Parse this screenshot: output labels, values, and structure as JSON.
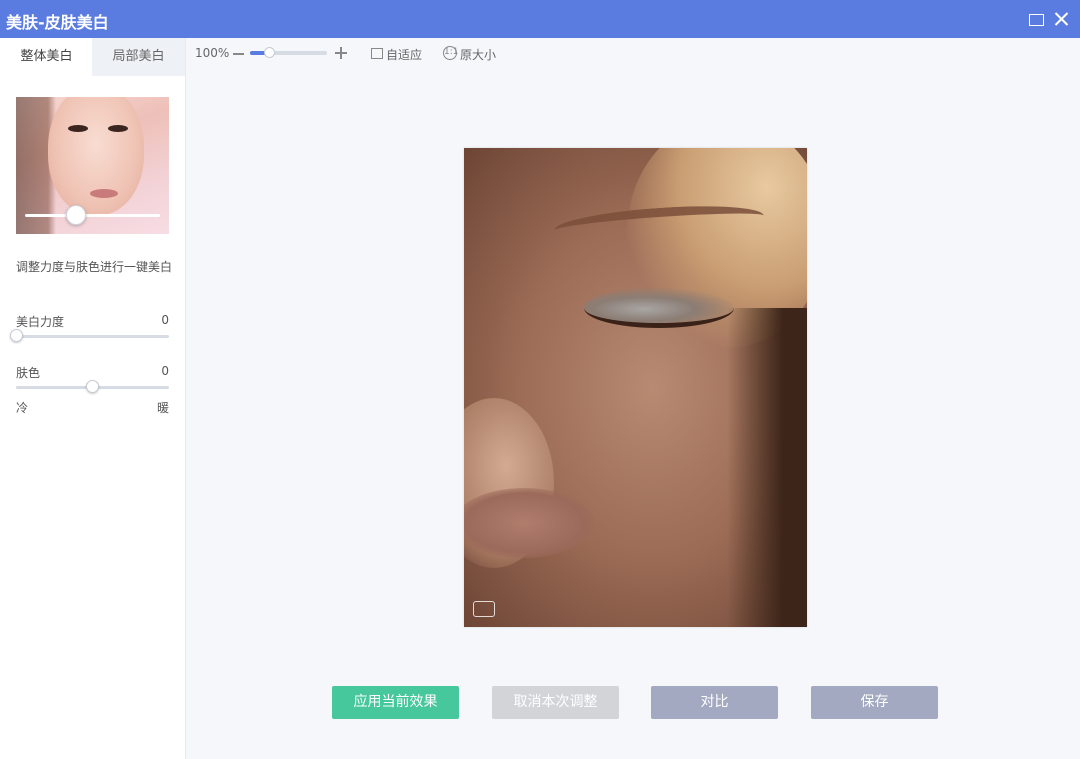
{
  "window": {
    "title": "美肤-皮肤美白"
  },
  "tabs": [
    {
      "label": "整体美白",
      "active": true
    },
    {
      "label": "局部美白",
      "active": false
    }
  ],
  "sidebar": {
    "description": "调整力度与肤色进行一键美白",
    "sliders": [
      {
        "label": "美白力度",
        "value": "0",
        "level": 0
      },
      {
        "label": "肤色",
        "value": "0",
        "level": 0.5,
        "min_label": "冷",
        "max_label": "暖"
      }
    ],
    "preview_level": 0.38
  },
  "toolbar": {
    "zoom_percent": "100%",
    "zoom_level": 0.25,
    "fit_label": "自适应",
    "original_label": "原大小",
    "original_icon_glyph": "1:1"
  },
  "actions": {
    "apply": "应用当前效果",
    "cancel": "取消本次调整",
    "compare": "对比",
    "save": "保存"
  },
  "colors": {
    "titlebar": "#5a7be0",
    "apply_button": "#46c79c",
    "cancel_button": "#d2d4d8",
    "compare_button": "#a3a9c1",
    "save_button": "#a3a9c1"
  },
  "icons": [
    "maximize-icon",
    "close-icon",
    "zoom-minus-icon",
    "zoom-plus-icon",
    "fit-icon",
    "original-size-icon",
    "watermark-logo"
  ]
}
